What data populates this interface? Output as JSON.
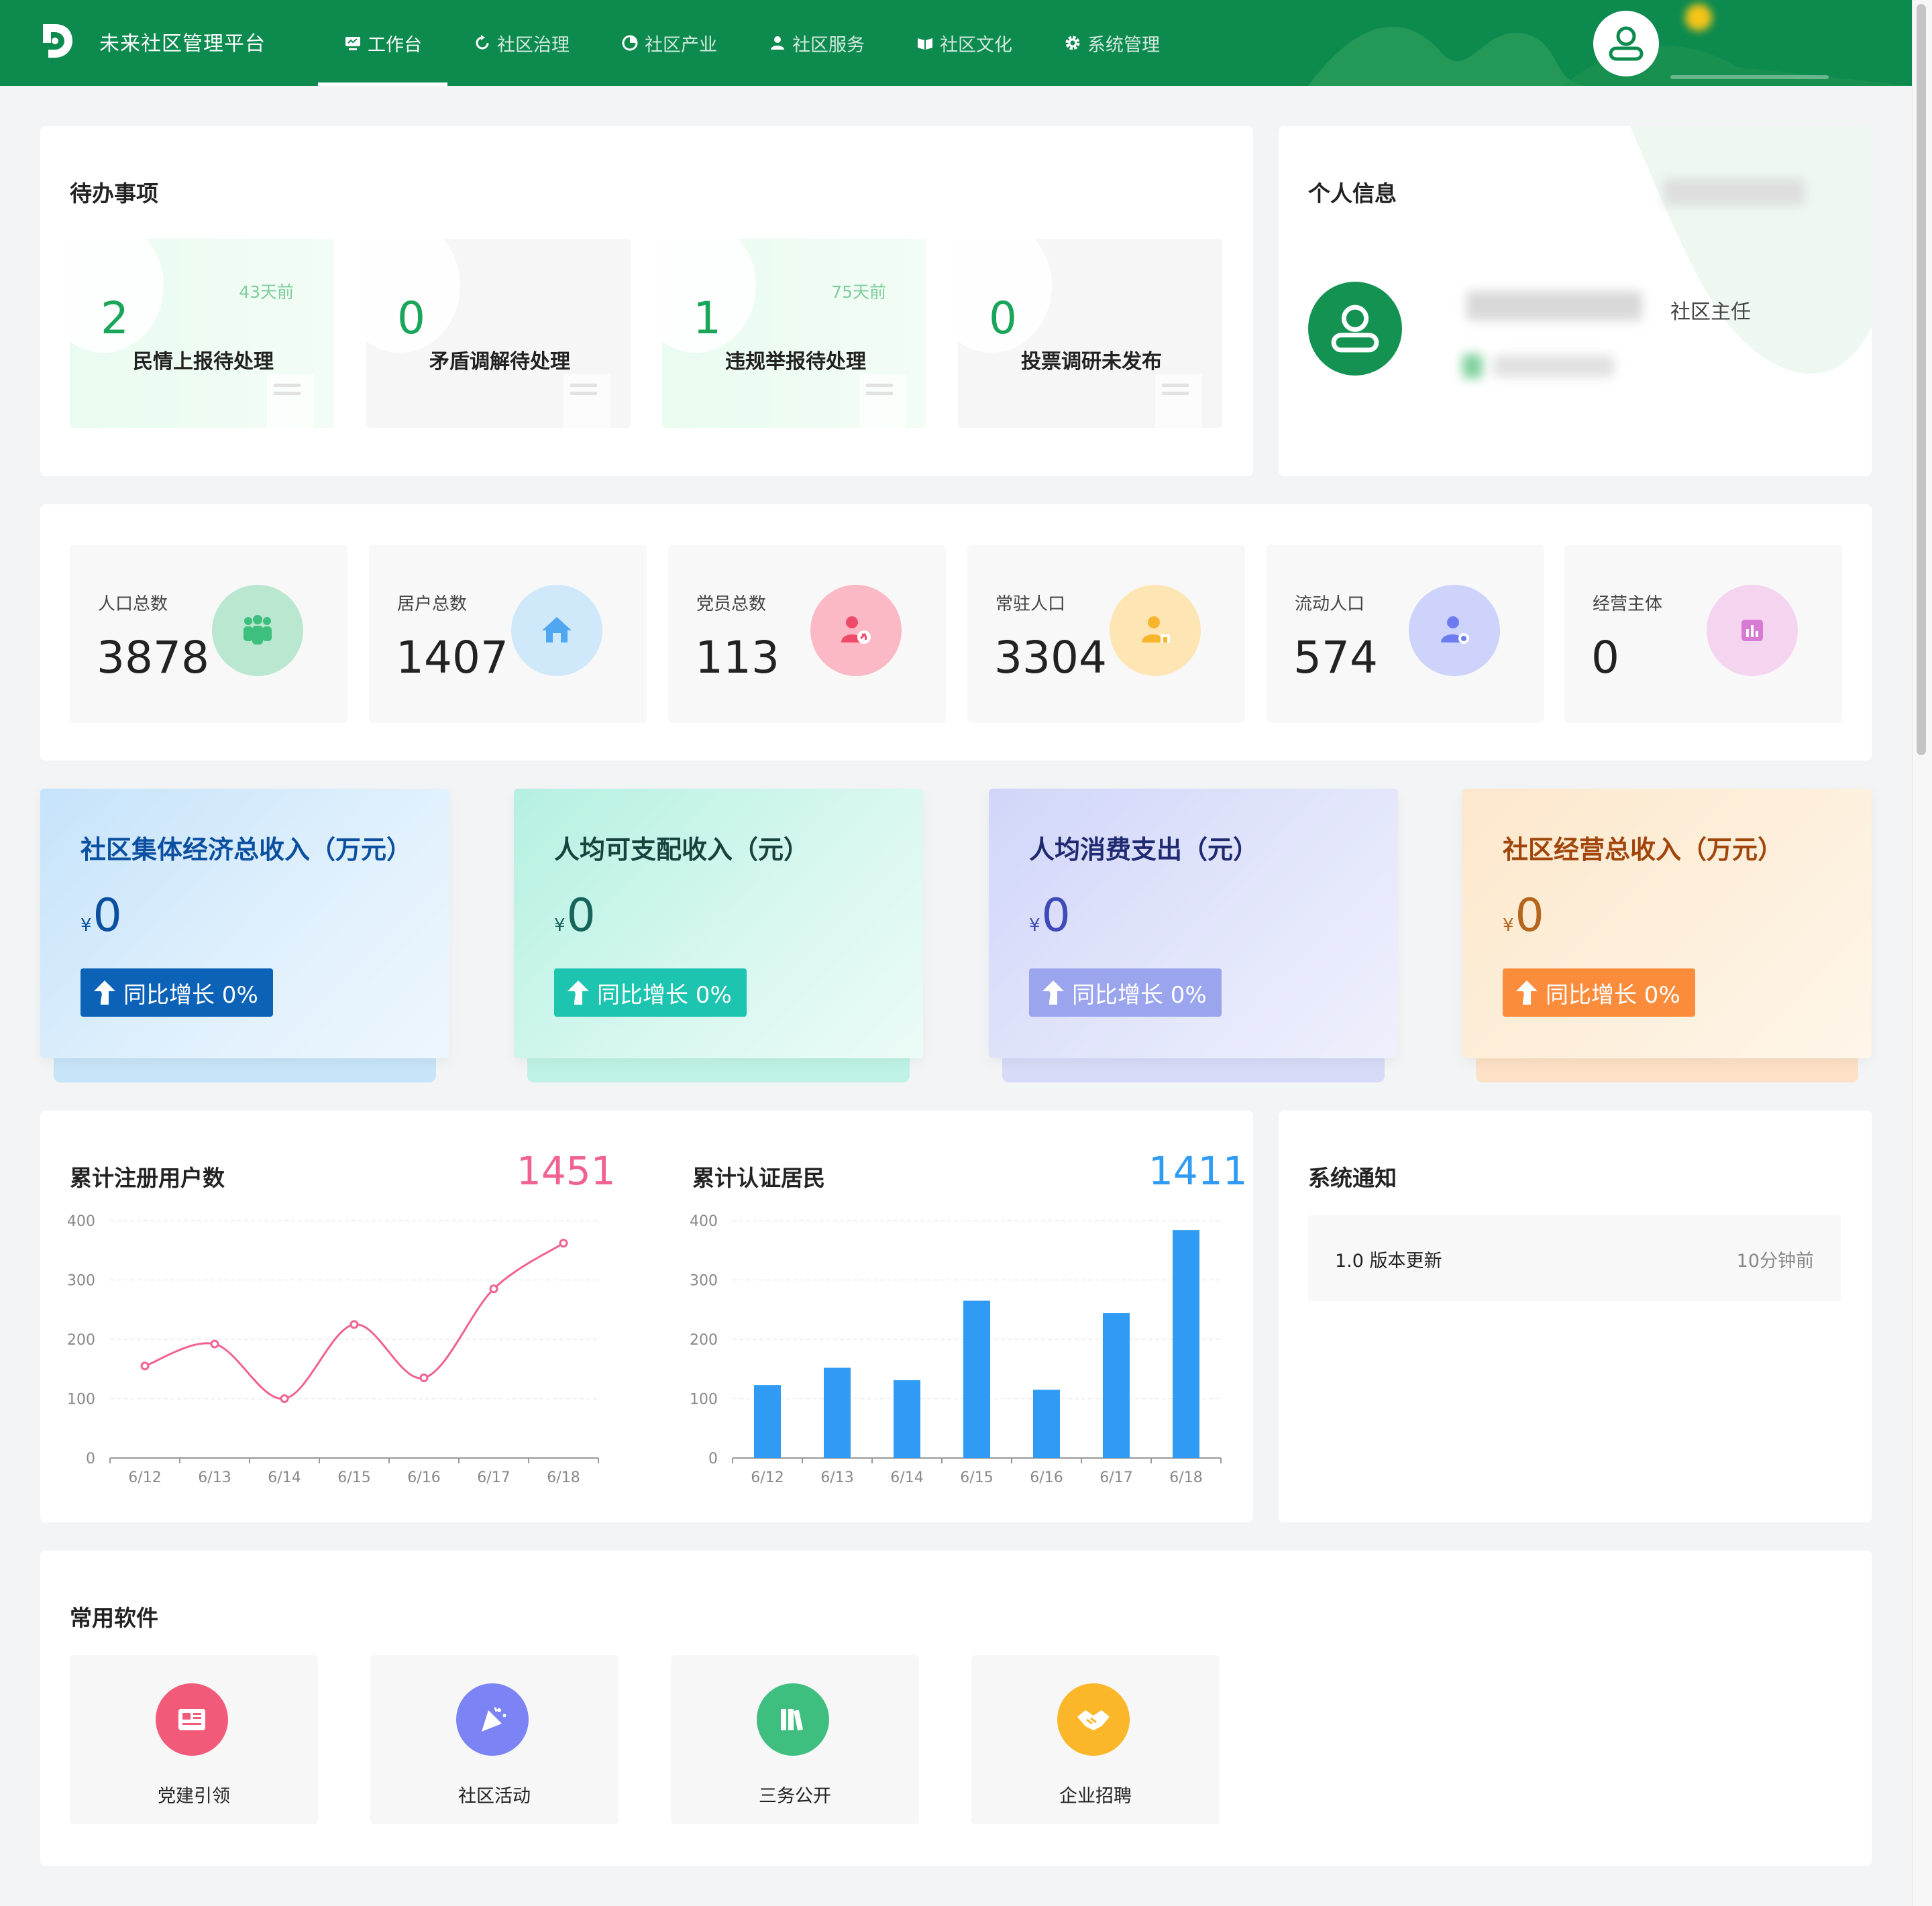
{
  "header": {
    "app_title": "未来社区管理平台",
    "nav": [
      {
        "label": "工作台",
        "icon": "monitor-icon"
      },
      {
        "label": "社区治理",
        "icon": "refresh-icon"
      },
      {
        "label": "社区产业",
        "icon": "pie-icon"
      },
      {
        "label": "社区服务",
        "icon": "user-service-icon"
      },
      {
        "label": "社区文化",
        "icon": "book-icon"
      },
      {
        "label": "系统管理",
        "icon": "gear-icon"
      }
    ],
    "colors": {
      "brand": "#0d8a4e"
    }
  },
  "todo": {
    "title": "待办事项",
    "items": [
      {
        "count": "2",
        "label": "民情上报待处理",
        "time": "43天前"
      },
      {
        "count": "0",
        "label": "矛盾调解待处理",
        "time": ""
      },
      {
        "count": "1",
        "label": "违规举报待处理",
        "time": "75天前"
      },
      {
        "count": "0",
        "label": "投票调研未发布",
        "time": ""
      }
    ]
  },
  "profile": {
    "title": "个人信息",
    "role": "社区主任"
  },
  "stats": [
    {
      "label": "人口总数",
      "value": "3878",
      "icon": "people-group-icon",
      "color": "#b9e7d0",
      "icon_color": "#3dbf7e"
    },
    {
      "label": "居户总数",
      "value": "1407",
      "icon": "home-icon",
      "color": "#cfe9fb",
      "icon_color": "#4fa7f0"
    },
    {
      "label": "党员总数",
      "value": "113",
      "icon": "party-member-icon",
      "color": "#fbb9c6",
      "icon_color": "#ef4a68"
    },
    {
      "label": "常驻人口",
      "value": "3304",
      "icon": "resident-icon",
      "color": "#fde6b4",
      "icon_color": "#f7b52c"
    },
    {
      "label": "流动人口",
      "value": "574",
      "icon": "floating-person-icon",
      "color": "#cdd3fb",
      "icon_color": "#6c7bef"
    },
    {
      "label": "经营主体",
      "value": "0",
      "icon": "bar-report-icon",
      "color": "#f5d4f0",
      "icon_color": "#d67ad4"
    }
  ],
  "economy": [
    {
      "title": "社区集体经济总收入（万元）",
      "currency": "¥",
      "value": "0",
      "badge": "同比增长 0%"
    },
    {
      "title": "人均可支配收入（元）",
      "currency": "¥",
      "value": "0",
      "badge": "同比增长 0%"
    },
    {
      "title": "人均消费支出（元）",
      "currency": "¥",
      "value": "0",
      "badge": "同比增长 0%"
    },
    {
      "title": "社区经营总收入（万元）",
      "currency": "¥",
      "value": "0",
      "badge": "同比增长 0%"
    }
  ],
  "chart_data": [
    {
      "type": "line",
      "title": "累计注册用户数",
      "total": "1451",
      "color": "#f06292",
      "categories": [
        "6/12",
        "6/13",
        "6/14",
        "6/15",
        "6/16",
        "6/17",
        "6/18"
      ],
      "values": [
        155,
        192,
        100,
        225,
        135,
        285,
        362
      ],
      "ylim": [
        0,
        400
      ],
      "yticks": [
        "0",
        "100",
        "200",
        "300",
        "400"
      ]
    },
    {
      "type": "bar",
      "title": "累计认证居民",
      "total": "1411",
      "color": "#2f9bf5",
      "categories": [
        "6/12",
        "6/13",
        "6/14",
        "6/15",
        "6/16",
        "6/17",
        "6/18"
      ],
      "values": [
        123,
        152,
        131,
        265,
        115,
        244,
        384
      ],
      "ylim": [
        0,
        400
      ],
      "yticks": [
        "0",
        "100",
        "200",
        "300",
        "400"
      ]
    }
  ],
  "notice": {
    "title": "系统通知",
    "items": [
      {
        "text": "1.0 版本更新",
        "time": "10分钟前"
      }
    ]
  },
  "apps": {
    "title": "常用软件",
    "items": [
      {
        "label": "党建引领",
        "icon": "party-news-icon",
        "color": "#f25a7a"
      },
      {
        "label": "社区活动",
        "icon": "party-popper-icon",
        "color": "#7b83f5"
      },
      {
        "label": "三务公开",
        "icon": "books-icon",
        "color": "#3fbf7f"
      },
      {
        "label": "企业招聘",
        "icon": "handshake-icon",
        "color": "#fbb62a"
      }
    ]
  }
}
